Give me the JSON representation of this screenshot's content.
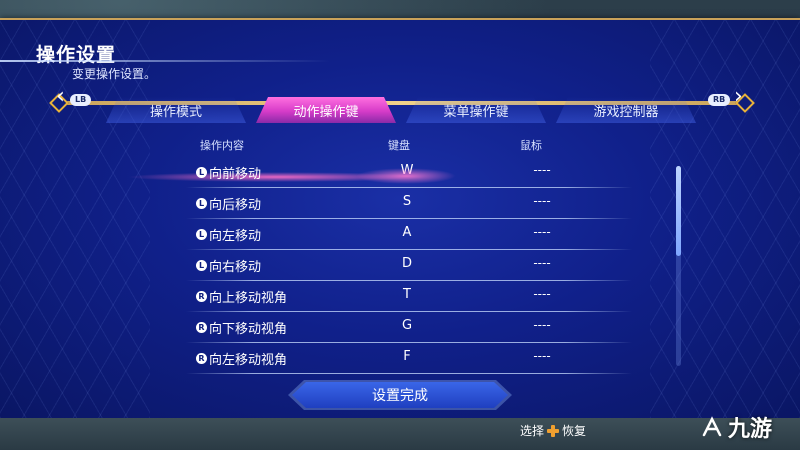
{
  "header": {
    "title": "操作设置",
    "subtitle": "变更操作设置。"
  },
  "tabbar": {
    "left_bumper": "LB",
    "right_bumper": "RB",
    "tabs": [
      {
        "label": "操作模式",
        "active": false
      },
      {
        "label": "动作操作键",
        "active": true
      },
      {
        "label": "菜单操作键",
        "active": false
      },
      {
        "label": "游戏控制器",
        "active": false
      }
    ]
  },
  "table": {
    "headers": {
      "action": "操作内容",
      "keyboard": "键盘",
      "mouse": "鼠标"
    },
    "rows": [
      {
        "stick": "L",
        "action": "向前移动",
        "key": "W",
        "mouse": "----"
      },
      {
        "stick": "L",
        "action": "向后移动",
        "key": "S",
        "mouse": "----"
      },
      {
        "stick": "L",
        "action": "向左移动",
        "key": "A",
        "mouse": "----"
      },
      {
        "stick": "L",
        "action": "向右移动",
        "key": "D",
        "mouse": "----"
      },
      {
        "stick": "R",
        "action": "向上移动视角",
        "key": "T",
        "mouse": "----"
      },
      {
        "stick": "R",
        "action": "向下移动视角",
        "key": "G",
        "mouse": "----"
      },
      {
        "stick": "R",
        "action": "向左移动视角",
        "key": "F",
        "mouse": "----"
      }
    ]
  },
  "scroll": {
    "position": 0.0,
    "visible_fraction": 0.45
  },
  "confirm_button": {
    "label": "设置完成"
  },
  "hints": {
    "select": "选择",
    "restore": "恢复"
  },
  "watermark": {
    "text": "九游"
  },
  "colors": {
    "panel_blue": "#10208a",
    "active_tab_pink": "#d63cc8",
    "gold_trim": "#c9a25a",
    "confirm_blue": "#2a52d8"
  }
}
